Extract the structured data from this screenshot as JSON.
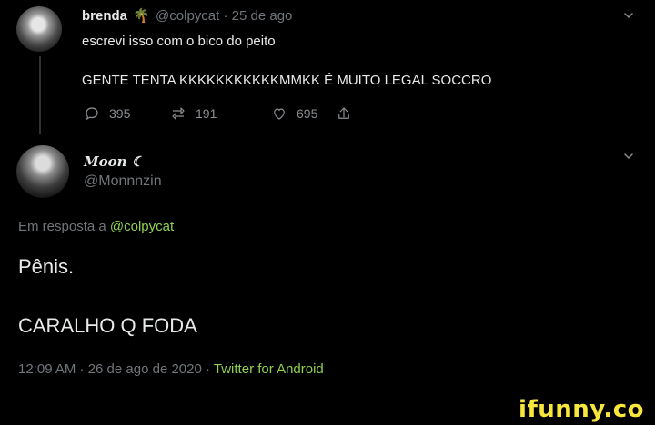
{
  "reply_to_tweet": {
    "display_name": "brenda",
    "emoji": "🌴",
    "handle": "@colpycat",
    "time": "· 25 de ago",
    "line1": "escrevi isso com o bico do peito",
    "line2": "GENTE TENTA KKKKKKKKKKKMMKK É MUITO LEGAL SOCCRO",
    "actions": {
      "reply_count": "395",
      "retweet_count": "191",
      "like_count": "695"
    }
  },
  "main_tweet": {
    "display_name": "Moon ☾",
    "handle": "@Monnnzin",
    "in_reply_prefix": "Em resposta a ",
    "in_reply_handle": "@colpycat",
    "text1": "Pênis.",
    "text2": "CARALHO Q FODA",
    "meta_time": "12:09 AM · 26 de ago de 2020 · ",
    "meta_source": "Twitter for Android"
  },
  "watermark": {
    "text": "ifunny.co"
  }
}
